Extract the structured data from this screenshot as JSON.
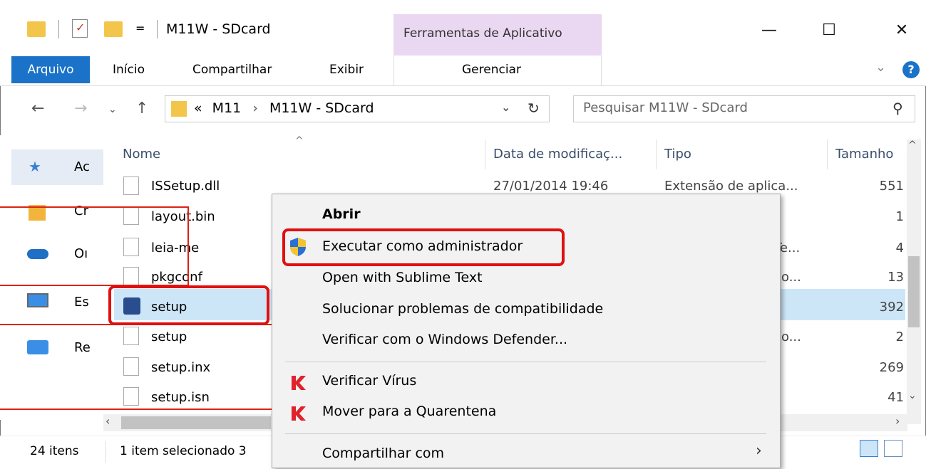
{
  "window": {
    "title": "M11W - SDcard",
    "context_group": "Ferramentas de Aplicativo",
    "qa_dropdown": "=",
    "minimize": "—",
    "maximize": "☐",
    "close": "✕"
  },
  "ribbon": {
    "tabs": [
      "Arquivo",
      "Início",
      "Compartilhar",
      "Exibir",
      "Gerenciar"
    ],
    "collapse_icon": "chevron-down-icon",
    "help": "?"
  },
  "address": {
    "path_prefix": "«",
    "path": [
      "M11",
      "M11W - SDcard"
    ],
    "separator": "›",
    "search_placeholder": "Pesquisar M11W - SDcard"
  },
  "nav_pane": {
    "items": [
      {
        "label": "Ac",
        "icon": "star-icon"
      },
      {
        "label": "Cr",
        "icon": "creative-cloud-icon"
      },
      {
        "label": "Oı",
        "icon": "onedrive-icon"
      },
      {
        "label": "Es",
        "icon": "this-pc-icon"
      },
      {
        "label": "Re",
        "icon": "network-icon"
      }
    ]
  },
  "file_list": {
    "columns": [
      "Nome",
      "Data de modificaç...",
      "Tipo",
      "Tamanho"
    ],
    "sort_indicator": "^",
    "rows": [
      {
        "name": "ISSetup.dll",
        "date": "27/01/2014 19:46",
        "type": "Extensão de aplica...",
        "size": "551",
        "icon": "dll-icon"
      },
      {
        "name": "layout.bin",
        "date": "",
        "type": "",
        "size": "1",
        "icon": "file-icon"
      },
      {
        "name": "leia-me",
        "date": "",
        "type": "Te...",
        "size": "4",
        "icon": "text-file-icon"
      },
      {
        "name": "pkgconf",
        "date": "",
        "type": "o...",
        "size": "13",
        "icon": "config-file-icon"
      },
      {
        "name": "setup",
        "date": "",
        "type": "",
        "size": "392",
        "icon": "setup-exe-icon",
        "selected": true
      },
      {
        "name": "setup",
        "date": "",
        "type": "o...",
        "size": "2",
        "icon": "config-file-icon"
      },
      {
        "name": "setup.inx",
        "date": "",
        "type": "",
        "size": "269",
        "icon": "file-icon"
      },
      {
        "name": "setup.isn",
        "date": "",
        "type": "",
        "size": "41",
        "icon": "file-icon"
      }
    ]
  },
  "context_menu": {
    "items": [
      {
        "label": "Abrir",
        "bold": true
      },
      {
        "label": "Executar como administrador",
        "icon": "uac-shield-icon"
      },
      {
        "label": "Open with Sublime Text"
      },
      {
        "label": "Solucionar problemas de compatibilidade"
      },
      {
        "label": "Verificar com o Windows Defender..."
      },
      {
        "label": "Verificar Vírus",
        "icon": "kaspersky-icon"
      },
      {
        "label": "Mover para a Quarentena",
        "icon": "kaspersky-icon"
      },
      {
        "label": "Compartilhar com",
        "submenu": true
      }
    ]
  },
  "status_bar": {
    "count": "24 itens",
    "selected": "1 item selecionado 3"
  },
  "colors": {
    "accent": "#1a73c8",
    "context_tab": "#ead7f1",
    "selection": "#cde6f7",
    "highlight": "#e01010"
  }
}
